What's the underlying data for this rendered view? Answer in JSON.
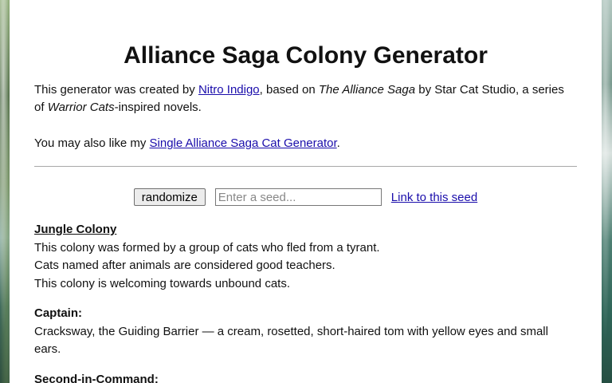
{
  "header": {
    "title": "Alliance Saga Colony Generator"
  },
  "intro": {
    "p1_a": "This generator was created by ",
    "author_link": "Nitro Indigo",
    "p1_b": ", based on ",
    "book_title": "The Alliance Saga",
    "p1_c": " by Star Cat Studio, a series of ",
    "series": "Warrior Cats",
    "p1_d": "-inspired novels.",
    "p2_a": "You may also like my ",
    "also_link": "Single Alliance Saga Cat Generator",
    "p2_b": "."
  },
  "controls": {
    "randomize_label": "randomize",
    "seed_placeholder": "Enter a seed...",
    "seed_value": "",
    "link_label": "Link to this seed"
  },
  "result": {
    "colony_name": "Jungle Colony",
    "lines": [
      "This colony was formed by a group of cats who fled from a tyrant.",
      "Cats named after animals are considered good teachers.",
      "This colony is welcoming towards unbound cats."
    ],
    "captain_heading": "Captain:",
    "captain_text": "Cracksway, the Guiding Barrier — a cream, rosetted, short-haired tom with yellow eyes and small ears.",
    "second_heading": "Second-in-Command:"
  }
}
